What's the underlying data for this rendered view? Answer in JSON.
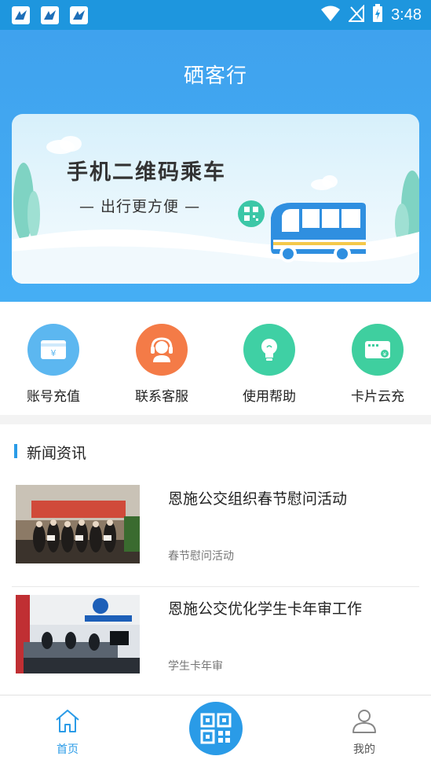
{
  "status_bar": {
    "time": "3:48"
  },
  "header": {
    "title": "硒客行"
  },
  "banner": {
    "title": "手机二维码乘车",
    "subtitle": "— 出行更方便 —"
  },
  "menu": [
    {
      "label": "账号充值",
      "icon": "wallet-icon",
      "color": "#5cb7f0"
    },
    {
      "label": "联系客服",
      "icon": "headset-icon",
      "color": "#f47b47"
    },
    {
      "label": "使用帮助",
      "icon": "lightbulb-icon",
      "color": "#3fd0a4"
    },
    {
      "label": "卡片云充",
      "icon": "card-icon",
      "color": "#3fcf9f"
    }
  ],
  "news": {
    "section_title": "新闻资讯",
    "items": [
      {
        "headline": "恩施公交组织春节慰问活动",
        "tag": "春节慰问活动"
      },
      {
        "headline": "恩施公交优化学生卡年审工作",
        "tag": "学生卡年审"
      }
    ]
  },
  "bottom_nav": {
    "home_label": "首页",
    "mine_label": "我的",
    "active_color": "#2a9be7"
  }
}
